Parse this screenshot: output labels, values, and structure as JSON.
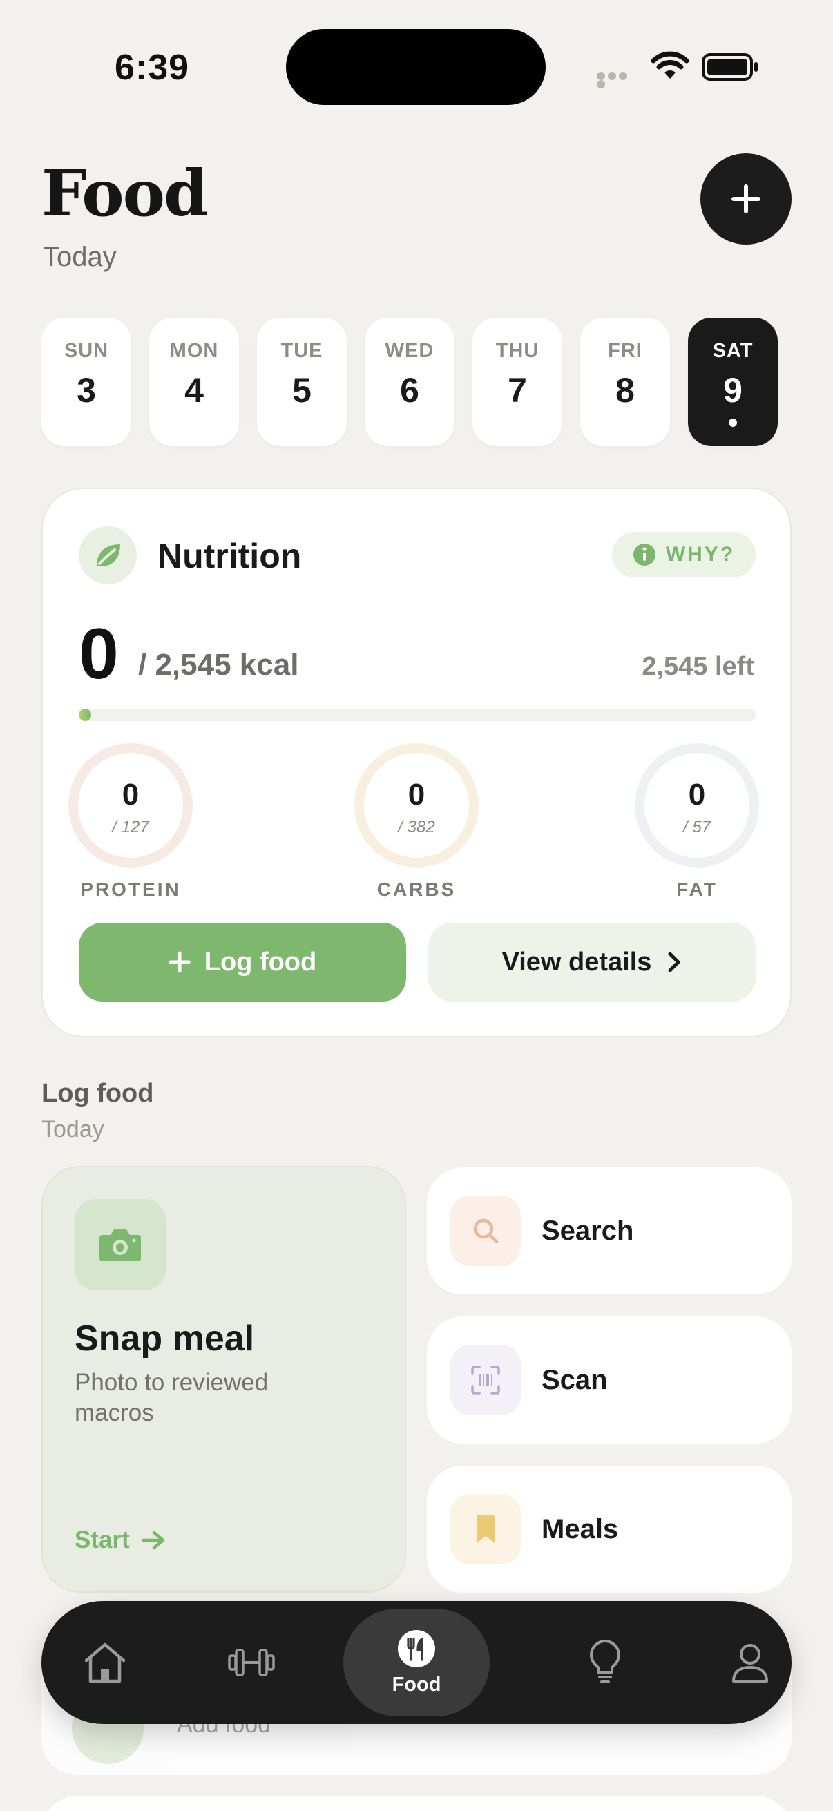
{
  "status_bar": {
    "time": "6:39"
  },
  "header": {
    "title": "Food",
    "subtitle": "Today"
  },
  "days": [
    {
      "name": "SUN",
      "num": "3"
    },
    {
      "name": "MON",
      "num": "4"
    },
    {
      "name": "TUE",
      "num": "5"
    },
    {
      "name": "WED",
      "num": "6"
    },
    {
      "name": "THU",
      "num": "7"
    },
    {
      "name": "FRI",
      "num": "8"
    },
    {
      "name": "SAT",
      "num": "9",
      "selected": true
    }
  ],
  "nutrition": {
    "title": "Nutrition",
    "why_label": "WHY?",
    "kcal_consumed": "0",
    "kcal_goal_text": "/ 2,545 kcal",
    "kcal_left_text": "2,545 left",
    "progress_fraction": 0,
    "macros": [
      {
        "label": "PROTEIN",
        "value": "0",
        "goal": "/ 127",
        "color": "#f7e9e3"
      },
      {
        "label": "CARBS",
        "value": "0",
        "goal": "/ 382",
        "color": "#f8f0df"
      },
      {
        "label": "FAT",
        "value": "0",
        "goal": "/ 57",
        "color": "#eef1f3"
      }
    ],
    "log_button": "Log food",
    "details_button": "View details"
  },
  "log_section": {
    "title": "Log food",
    "subtitle": "Today",
    "snap": {
      "title": "Snap meal",
      "description": "Photo to reviewed macros",
      "cta": "Start"
    },
    "actions": [
      {
        "label": "Search",
        "icon": "search-icon",
        "tile_color": "#fbefe7"
      },
      {
        "label": "Scan",
        "icon": "barcode-scan-icon",
        "tile_color": "#f3f0f8"
      },
      {
        "label": "Meals",
        "icon": "bookmark-icon",
        "tile_color": "#fbf4e4"
      }
    ]
  },
  "peek": {
    "label": "Add food"
  },
  "tabbar": {
    "items": [
      {
        "icon": "home-icon"
      },
      {
        "icon": "dumbbell-icon"
      },
      {
        "icon": "fork-knife-icon",
        "label": "Food",
        "active": true
      },
      {
        "icon": "lightbulb-icon"
      },
      {
        "icon": "profile-icon"
      }
    ]
  },
  "colors": {
    "accent_green": "#7db86e",
    "dark": "#1c1c1c",
    "background": "#f3f1ed"
  }
}
